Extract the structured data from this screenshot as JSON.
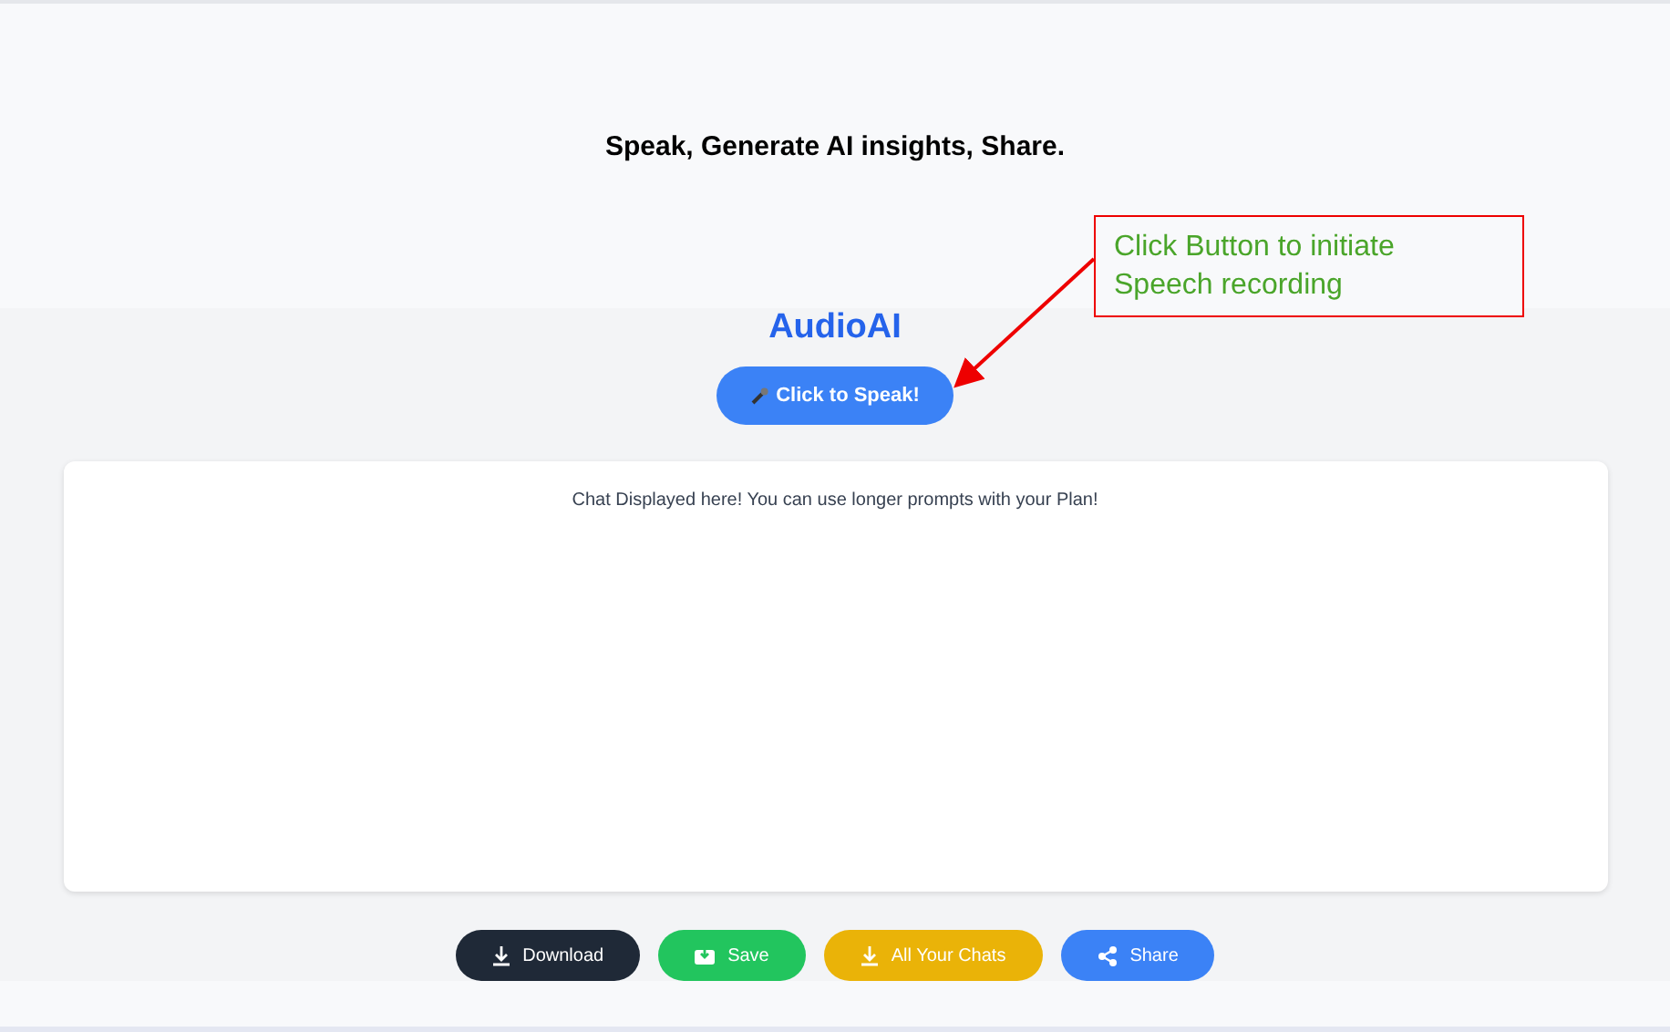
{
  "header": {
    "tagline": "Speak, Generate AI insights, Share."
  },
  "app": {
    "title": "AudioAI",
    "speak_button": "Click to Speak!"
  },
  "callout": {
    "text": "Click Button to initiate Speech recording"
  },
  "chat": {
    "message": "Chat Displayed here! You can use longer prompts with your Plan!"
  },
  "actions": [
    {
      "kind": "download",
      "label": "Download"
    },
    {
      "kind": "save",
      "label": "Save"
    },
    {
      "kind": "chats",
      "label": "All Your Chats"
    },
    {
      "kind": "share",
      "label": "Share"
    }
  ]
}
